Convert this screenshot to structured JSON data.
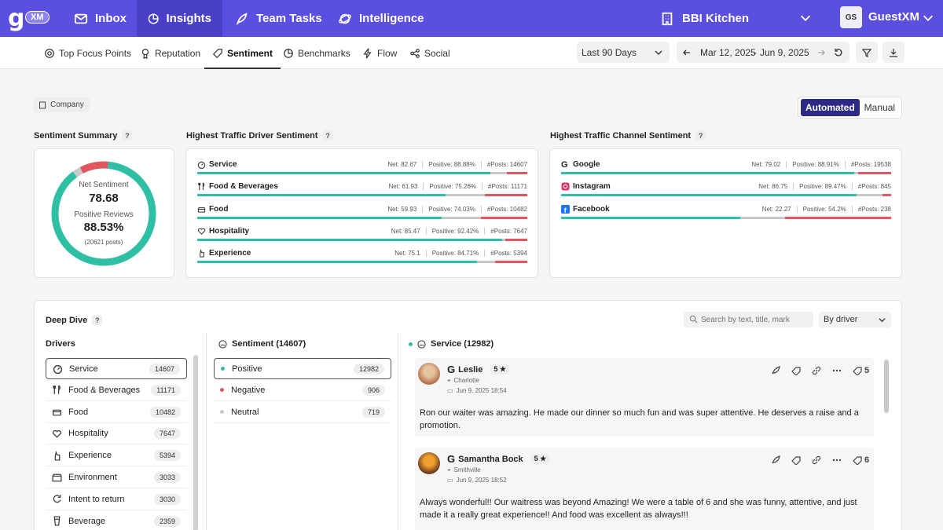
{
  "logo": {
    "letter": "g",
    "badge": "XM"
  },
  "nav": {
    "inbox": "Inbox",
    "insights": "Insights",
    "team_tasks": "Team Tasks",
    "intelligence": "Intelligence"
  },
  "brand": {
    "name": "BBI Kitchen"
  },
  "user": {
    "initials": "GS",
    "name": "GuestXM"
  },
  "subtabs": {
    "focus": "Top Focus Points",
    "reputation": "Reputation",
    "sentiment": "Sentiment",
    "benchmarks": "Benchmarks",
    "flow": "Flow",
    "social": "Social"
  },
  "range": {
    "label": "Last 90 Days",
    "start": "Mar 12, 2025",
    "sep": "-",
    "end": "Jun 9, 2025"
  },
  "scope": {
    "chip": "Company",
    "auto": "Automated",
    "manual": "Manual"
  },
  "summary": {
    "title": "Sentiment Summary",
    "q": "?",
    "net_label": "Net Sentiment",
    "net_value": "78.68",
    "pos_label": "Positive Reviews",
    "pos_value": "88.53%",
    "posts": "(20621 posts)",
    "donut": {
      "positive": 88.53,
      "neutral": 2.5,
      "negative": 8.97
    }
  },
  "drivers": {
    "title": "Highest Traffic Driver Sentiment",
    "q": "?",
    "rows": [
      {
        "name": "Service",
        "net": "Net: 82.67",
        "pos": "Positive: 88.88%",
        "posts": "#Posts: 14607",
        "p": 88.88,
        "n": 5.0,
        "g": 6.12
      },
      {
        "name": "Food & Beverages",
        "net": "Net: 61.93",
        "pos": "Positive: 75.26%",
        "posts": "#Posts: 11171",
        "p": 75.26,
        "n": 12.0,
        "g": 12.74
      },
      {
        "name": "Food",
        "net": "Net: 59.93",
        "pos": "Positive: 74.03%",
        "posts": "#Posts: 10482",
        "p": 74.03,
        "n": 12.0,
        "g": 13.97
      },
      {
        "name": "Hospitality",
        "net": "Net: 85.47",
        "pos": "Positive: 92.42%",
        "posts": "#Posts: 7647",
        "p": 92.42,
        "n": 1.0,
        "g": 6.58
      },
      {
        "name": "Experience",
        "net": "Net: 75.1",
        "pos": "Positive: 84.71%",
        "posts": "#Posts: 5394",
        "p": 84.71,
        "n": 5.6,
        "g": 9.69
      }
    ]
  },
  "channels": {
    "title": "Highest Traffic Channel Sentiment",
    "q": "?",
    "rows": [
      {
        "name": "Google",
        "net": "Net: 79.02",
        "pos": "Positive: 88.91%",
        "posts": "#Posts: 19538",
        "p": 88.91,
        "n": 1.2,
        "g": 9.89
      },
      {
        "name": "Instagram",
        "net": "Net: 86.75",
        "pos": "Positive: 89.47%",
        "posts": "#Posts: 845",
        "p": 89.47,
        "n": 7.8,
        "g": 2.73
      },
      {
        "name": "Facebook",
        "net": "Net: 22.27",
        "pos": "Positive: 54.2%",
        "posts": "#Posts: 238",
        "p": 54.2,
        "n": 13.7,
        "g": 32.1
      }
    ]
  },
  "deep": {
    "title": "Deep Dive",
    "q": "?",
    "search_placeholder": "Search by text, title, mark",
    "by": "By driver",
    "drivers_title": "Drivers",
    "sentiment_title": "Sentiment (14607)",
    "service_title": "Service (12982)"
  },
  "driver_list": [
    {
      "name": "Service",
      "count": "14607"
    },
    {
      "name": "Food & Beverages",
      "count": "11171"
    },
    {
      "name": "Food",
      "count": "10482"
    },
    {
      "name": "Hospitality",
      "count": "7647"
    },
    {
      "name": "Experience",
      "count": "5394"
    },
    {
      "name": "Environment",
      "count": "3033"
    },
    {
      "name": "Intent to return",
      "count": "3030"
    },
    {
      "name": "Beverage",
      "count": "2359"
    }
  ],
  "sentiment_list": [
    {
      "name": "Positive",
      "count": "12982",
      "color": "#2fbfa5"
    },
    {
      "name": "Negative",
      "count": "906",
      "color": "#e0575f"
    },
    {
      "name": "Neutral",
      "count": "719",
      "color": "#c9c9c9"
    }
  ],
  "posts": [
    {
      "author": "Leslie",
      "rating": "5 ★",
      "location": "Charlotte",
      "date": "Jun 9, 2025 18:54",
      "likes": "5",
      "text": "Ron our waiter was amazing. He made our dinner so much fun and was super attentive. He deserves a raise and a promotion."
    },
    {
      "author": "Samantha Bock",
      "rating": "5 ★",
      "location": "Smithville",
      "date": "Jun 9, 2025 18:52",
      "likes": "6",
      "text": "Always wonderful!! Our waitress was beyond Amazing! We were a table of 6 and she was funny, attentive, and just made it a really great experience!! And food was excellent as always!!!"
    }
  ],
  "colors": {
    "primary": "#5b4fe0",
    "positive": "#2fbfa5",
    "negative": "#e0575f",
    "neutral": "#c9c9c9"
  }
}
